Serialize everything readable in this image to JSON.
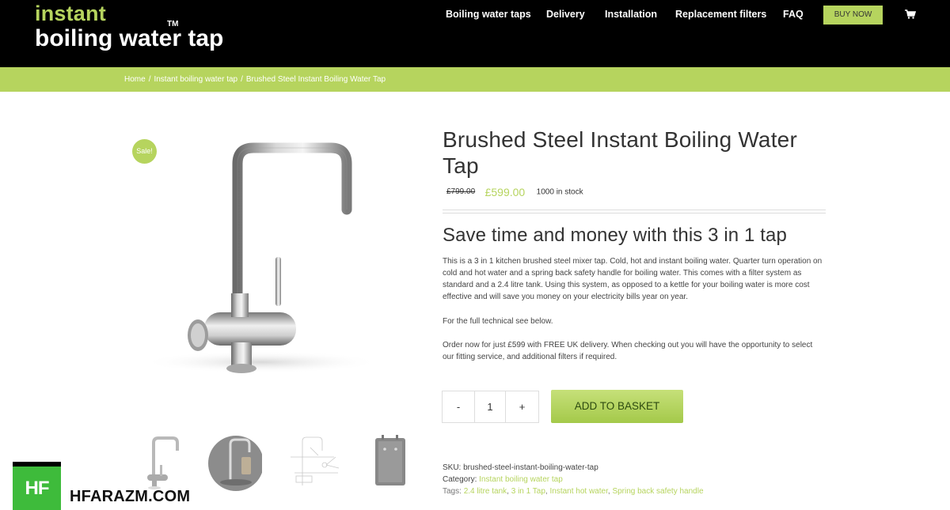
{
  "header": {
    "logo_top": "instant",
    "logo_bottom": "boiling water tap",
    "logo_tm": "TM",
    "nav": [
      "Boiling water taps",
      "Delivery",
      "Installation",
      "Replacement filters",
      "FAQ"
    ],
    "buy_label": "BUY NOW",
    "cart_icon": "shopping-cart-icon"
  },
  "breadcrumb": {
    "home": "Home",
    "category": "Instant boiling water tap",
    "current": "Brushed Steel Instant Boiling Water Tap",
    "separator": "/"
  },
  "gallery": {
    "sale_badge": "Sale!",
    "thumbnails": [
      "tap-front",
      "tap-in-use",
      "tap-diagram",
      "boiler-tank"
    ]
  },
  "product": {
    "title": "Brushed Steel Instant Boiling Water Tap",
    "old_price": "£799.00",
    "new_price": "£599.00",
    "stock": "1000 in stock",
    "subtitle": "Save time and money with this 3 in 1 tap",
    "description": "This is a 3 in 1 kitchen brushed steel mixer tap. Cold, hot and instant boiling water. Quarter turn operation on cold and hot water and a spring back safety handle for boiling water. This comes with a filter system as standard and a 2.4 litre tank. Using this system, as opposed to a kettle for your boiling water is more cost effective and will save you money on your electricity bills year on year.",
    "technical_note": "For the full technical see below.",
    "order_note": "Order now for just £599 with FREE UK delivery. When checking out you will have the opportunity to select our fitting service, and additional filters if required."
  },
  "cart": {
    "minus": "-",
    "quantity": "1",
    "plus": "+",
    "add_label": "ADD TO BASKET"
  },
  "meta": {
    "sku_label": "SKU:",
    "sku": "brushed-steel-instant-boiling-water-tap",
    "category_label": "Category:",
    "category": "Instant boiling water tap",
    "tags_label": "Tags:",
    "tags": [
      "2.4 litre tank",
      "3 in 1 Tap",
      "Instant hot water",
      "Spring back safety handle"
    ]
  },
  "watermark": {
    "badge": "HF",
    "text": "HFARAZM.COM"
  },
  "colors": {
    "accent": "#b6d45e",
    "header_bg": "#000000",
    "watermark_green": "#3ebb3b"
  }
}
